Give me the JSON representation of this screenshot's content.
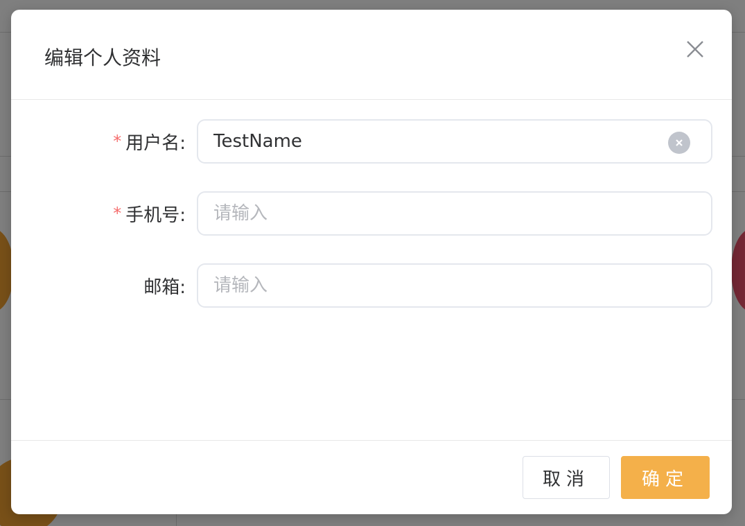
{
  "dialog": {
    "title": "编辑个人资料",
    "close_icon": "close-icon"
  },
  "form": {
    "username": {
      "label": "用户名:",
      "required": true,
      "value": "TestName",
      "placeholder": "请输入",
      "clear_icon": "circle-x-icon"
    },
    "phone": {
      "label": "手机号:",
      "required": true,
      "value": "",
      "placeholder": "请输入"
    },
    "email": {
      "label": "邮箱:",
      "required": false,
      "value": "",
      "placeholder": "请输入"
    },
    "required_mark": "*"
  },
  "footer": {
    "cancel_label": "取消",
    "confirm_label": "确定"
  },
  "colors": {
    "accent": "#f4b04a",
    "required": "#f56c6c",
    "overlay": "rgba(0,0,0,0.5)",
    "clear_icon": "#c0c4cc"
  }
}
